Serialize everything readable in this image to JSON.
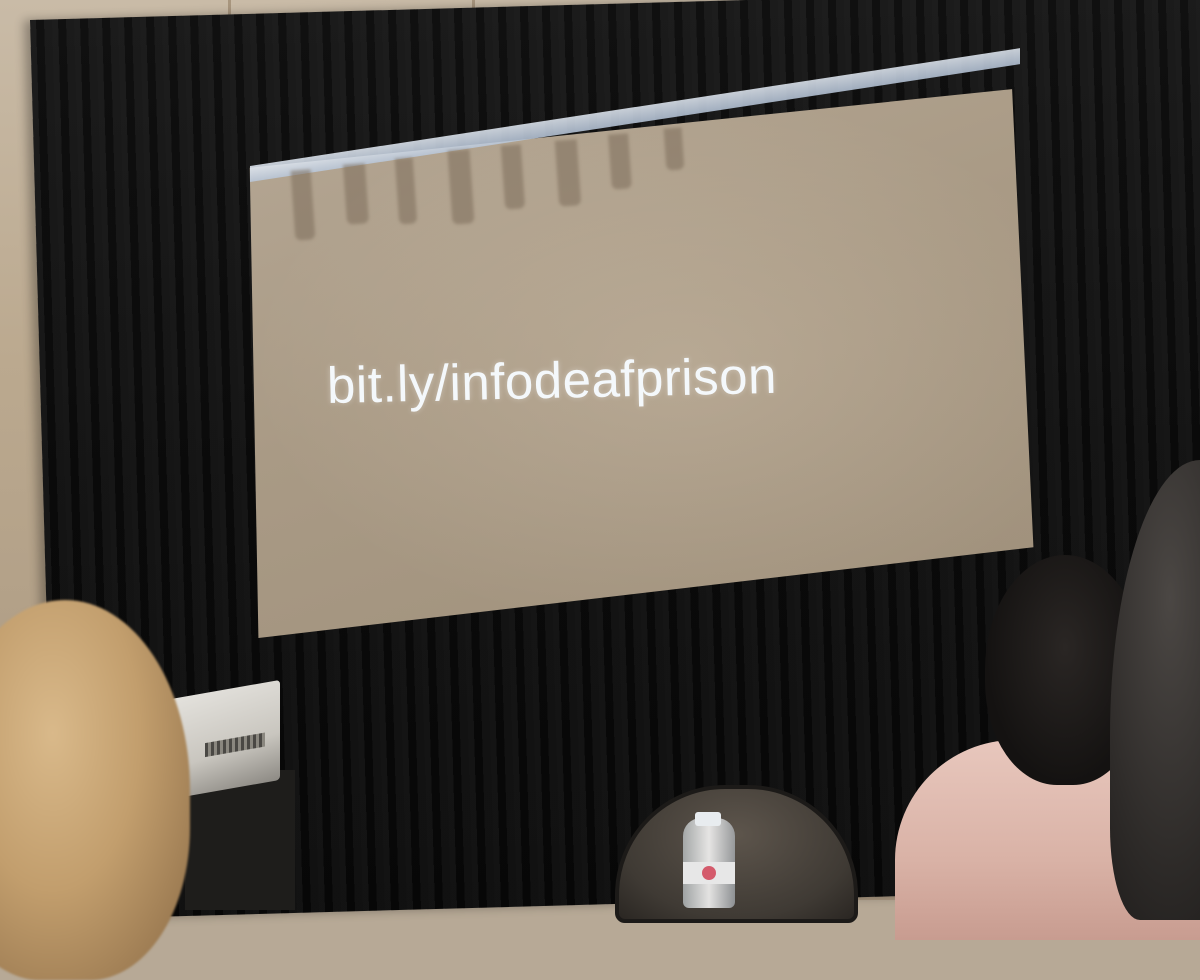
{
  "slide": {
    "text": "bit.ly/infodeafprison"
  },
  "colors": {
    "screen": "#a99a85",
    "slide_text": "#f4f8fb",
    "curtain": "#0c0c0c",
    "wall": "#bba98f"
  }
}
